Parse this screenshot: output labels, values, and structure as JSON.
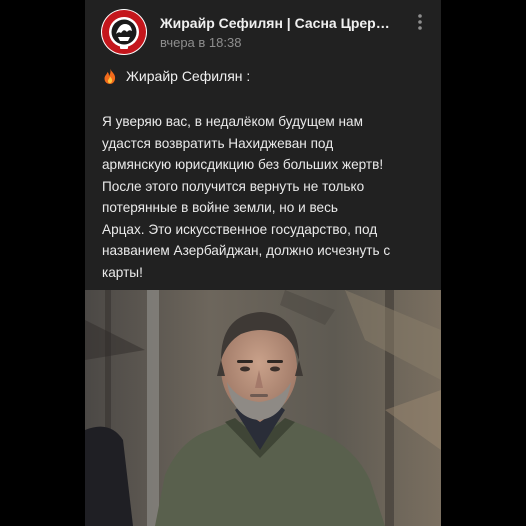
{
  "post": {
    "channel_title": "Жирайр Сефилян | Сасна Црер…",
    "timestamp": "вчера в 18:38",
    "author": "Жирайр Сефилян :",
    "author_icon": "fire-icon",
    "text_lines": [
      "Я уверяю вас, в недалёком будущем нам",
      "удастся возвратить Нахиджеван под",
      "армянскую юрисдикцию без больших жертв!",
      "После этого получится вернуть не только",
      "потерянные в войне земли, но и весь",
      "Арцах. Это искусственное государство, под",
      "названием Азербайджан, должно исчезнуть с",
      "карты!"
    ]
  },
  "icons": {
    "avatar": "channel-logo",
    "menu": "more-vertical-icon"
  },
  "colors": {
    "card_background": "#212121",
    "page_background": "#000000",
    "title_text": "#f0f0f0",
    "meta_text": "#8e8e8e",
    "logo_red": "#c4161c"
  }
}
